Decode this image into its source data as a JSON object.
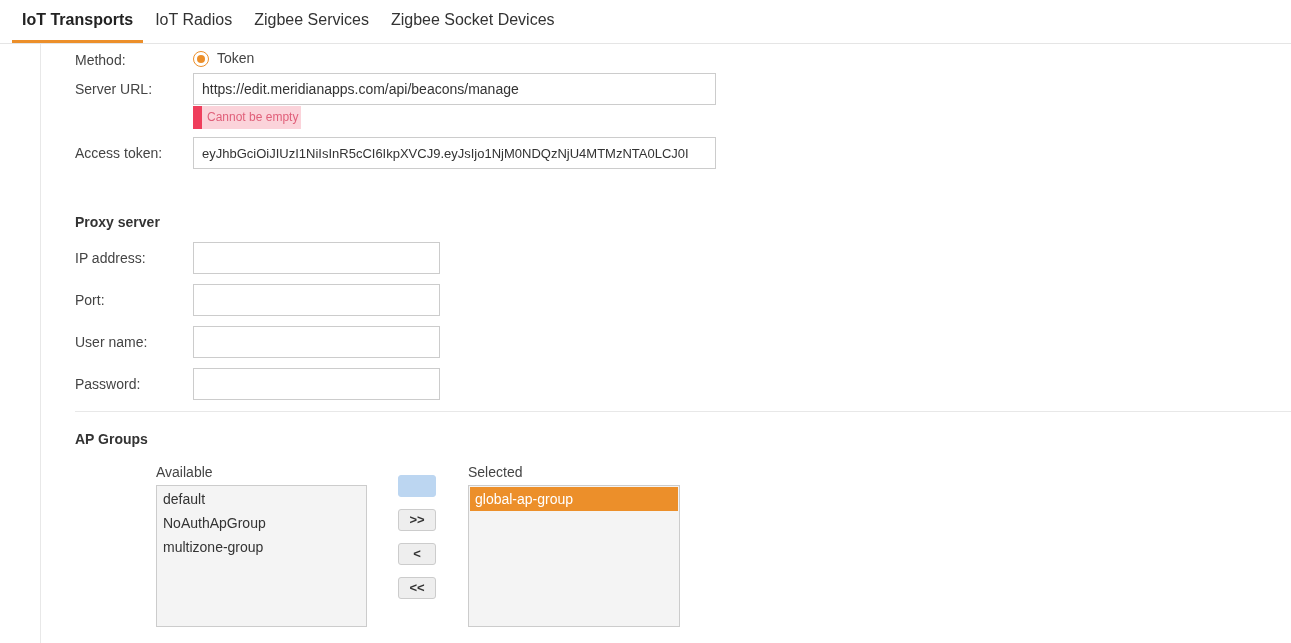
{
  "tabs": [
    {
      "label": "IoT Transports",
      "selected": true
    },
    {
      "label": "IoT Radios",
      "selected": false
    },
    {
      "label": "Zigbee Services",
      "selected": false
    },
    {
      "label": "Zigbee Socket Devices",
      "selected": false
    }
  ],
  "method": {
    "label": "Method:",
    "option": "Token",
    "selected": true
  },
  "server_url": {
    "label": "Server URL:",
    "value": "https://edit.meridianapps.com/api/beacons/manage",
    "error": "Cannot be empty"
  },
  "access_token": {
    "label": "Access token:",
    "value": "eyJhbGciOiJIUzI1NiIsInR5cCI6IkpXVCJ9.eyJsIjo1NjM0NDQzNjU4MTMzNTA0LCJ0I"
  },
  "proxy_server": {
    "title": "Proxy server",
    "fields": [
      {
        "label": "IP address:"
      },
      {
        "label": "Port:"
      },
      {
        "label": "User name:"
      },
      {
        "label": "Password:"
      }
    ]
  },
  "ap_groups": {
    "title": "AP Groups",
    "available": {
      "label": "Available",
      "items": [
        {
          "label": "default",
          "selected": false
        },
        {
          "label": "NoAuthApGroup",
          "selected": false
        },
        {
          "label": "multizone-group",
          "selected": false
        }
      ]
    },
    "buttons": [
      {
        "hovered": true
      },
      {
        "label": ">>",
        "hovered": false
      },
      {
        "label": "<",
        "hovered": false
      },
      {
        "label": "<<",
        "hovered": false
      }
    ],
    "selected": {
      "label": "Selected",
      "items": [
        {
          "label": "global-ap-group",
          "selected": true
        }
      ]
    }
  }
}
